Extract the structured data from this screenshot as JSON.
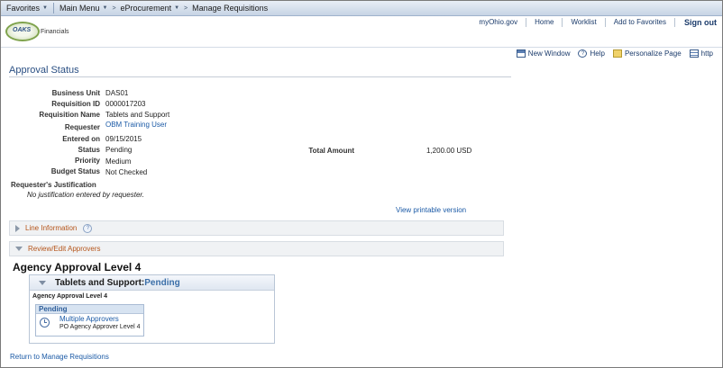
{
  "topnav": {
    "favorites": "Favorites",
    "main_menu": "Main Menu",
    "crumbs": [
      "eProcurement",
      "Manage Requisitions"
    ]
  },
  "header": {
    "logo_text": "OAKS",
    "logo_sub": "Financials",
    "links": [
      "myOhio.gov",
      "Home",
      "Worklist",
      "Add to Favorites"
    ],
    "signout": "Sign out"
  },
  "toolbar": {
    "new_window": "New Window",
    "help": "Help",
    "personalize": "Personalize Page",
    "http": "http"
  },
  "page": {
    "title": "Approval Status"
  },
  "fields": {
    "business_unit_label": "Business Unit",
    "business_unit": "DAS01",
    "requisition_id_label": "Requisition ID",
    "requisition_id": "0000017203",
    "requisition_name_label": "Requisition Name",
    "requisition_name": "Tablets and Support",
    "requester_label": "Requester",
    "requester": "OBM Training User",
    "entered_on_label": "Entered on",
    "entered_on": "09/15/2015",
    "status_label": "Status",
    "status": "Pending",
    "priority_label": "Priority",
    "priority": "Medium",
    "budget_status_label": "Budget Status",
    "budget_status": "Not Checked",
    "total_amount_label": "Total Amount",
    "total_amount": "1,200.00 USD"
  },
  "justification": {
    "label": "Requester's Justification",
    "value": "No justification entered by requester."
  },
  "print_link": "View printable version",
  "sections": {
    "line_information": "Line Information",
    "review_edit": "Review/Edit Approvers"
  },
  "approval": {
    "level_title": "Agency Approval Level 4",
    "header_name": "Tablets and Support:",
    "header_status": "Pending",
    "sub_label": "Agency Approval Level 4",
    "pending_label": "Pending",
    "approvers_link": "Multiple Approvers",
    "approver_role": "PO Agency Approver Level 4"
  },
  "return_link": "Return to Manage Requisitions"
}
